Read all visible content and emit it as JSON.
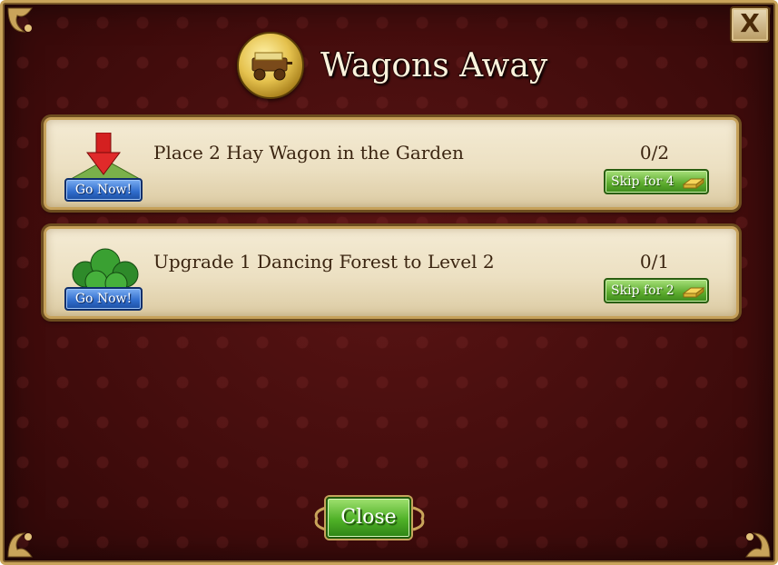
{
  "dialog": {
    "title": "Wagons Away",
    "close_x_label": "X",
    "close_button_label": "Close"
  },
  "quests": [
    {
      "icon": "arrow-down-icon",
      "text": "Place 2 Hay Wagon in the Garden",
      "progress": "0/2",
      "go_label": "Go Now!",
      "skip_label": "Skip for 4"
    },
    {
      "icon": "forest-icon",
      "text": "Upgrade 1 Dancing Forest to Level 2",
      "progress": "0/1",
      "go_label": "Go Now!",
      "skip_label": "Skip for 2"
    }
  ],
  "colors": {
    "background": "#4a0f0f",
    "panel": "#ece0c2",
    "go_button": "#2f6ccc",
    "skip_button": "#5cab2d",
    "border_gold": "#c6a15a"
  }
}
